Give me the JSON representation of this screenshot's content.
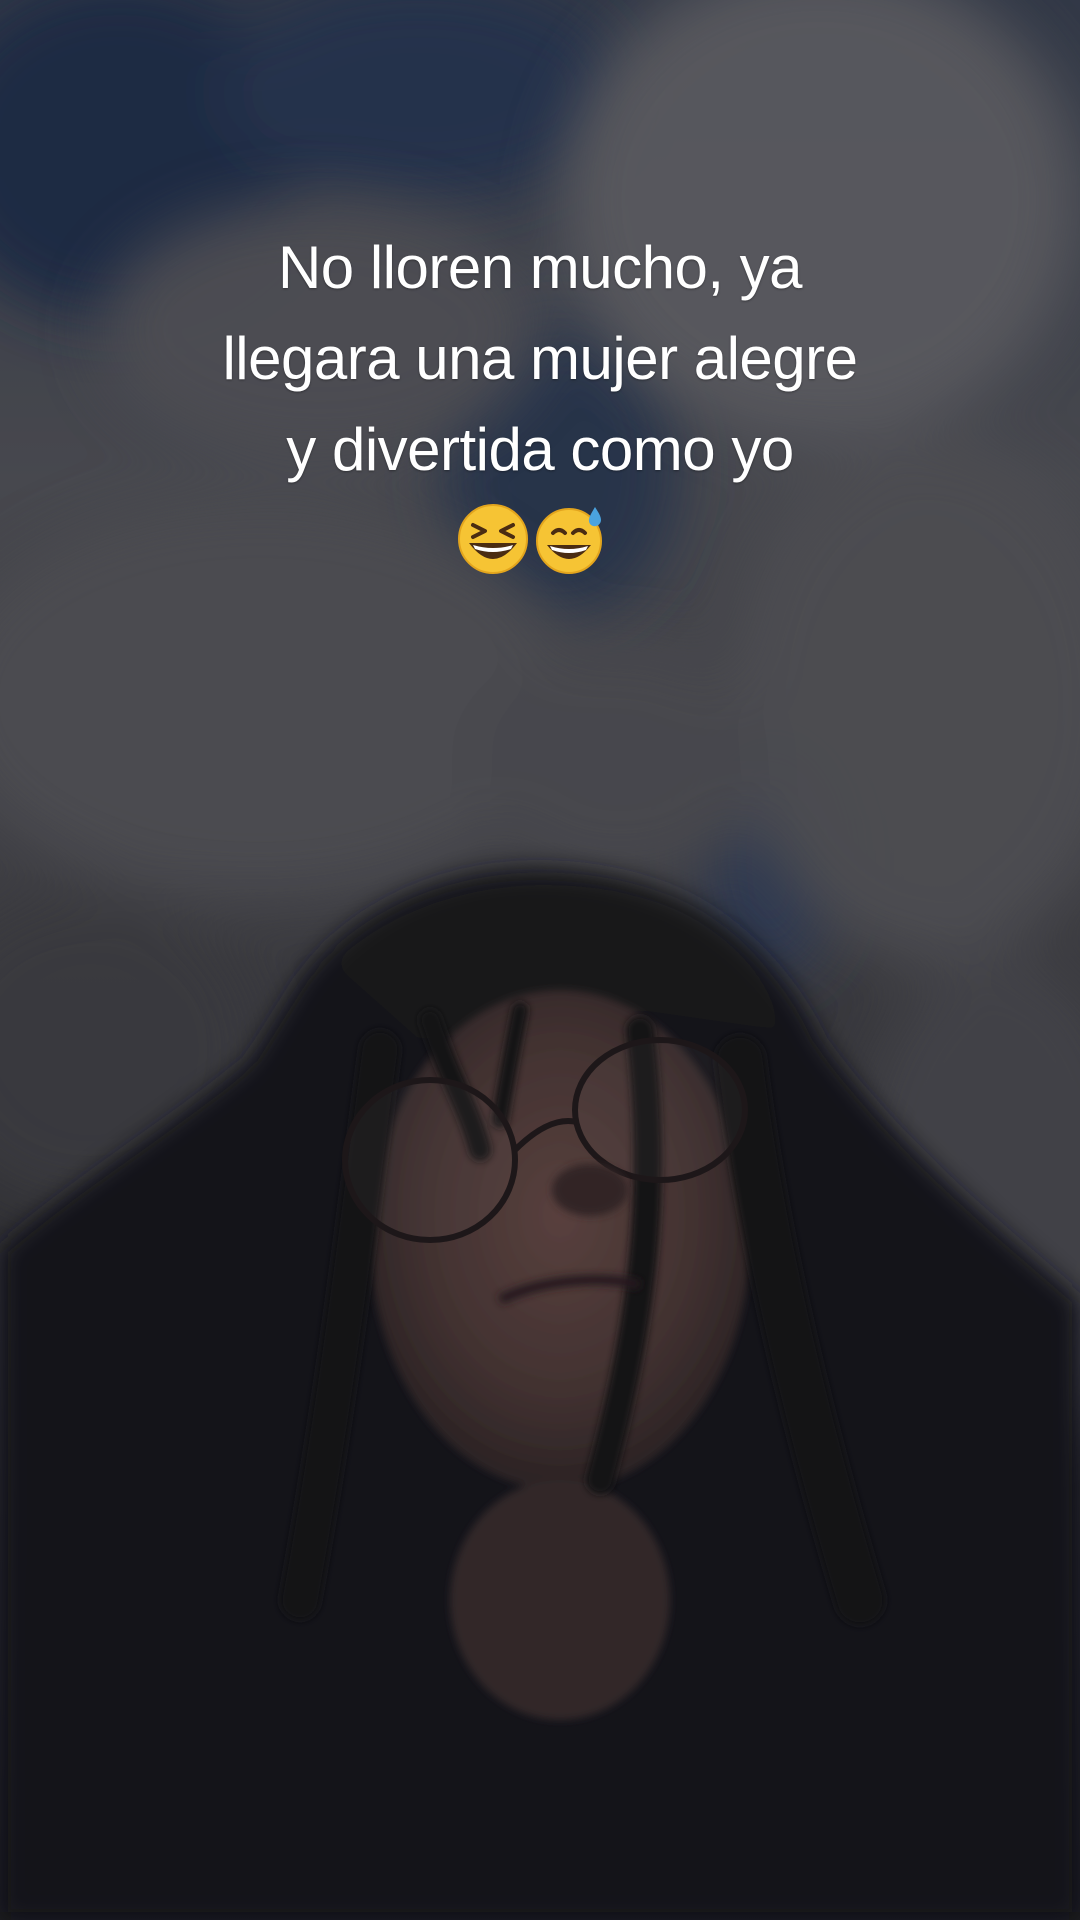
{
  "caption": {
    "lines": [
      "No lloren mucho, ya",
      "llegara una mujer alegre",
      "y divertida como yo"
    ],
    "emoji_names": [
      "grinning-squinting-face-icon",
      "grinning-face-with-sweat-icon"
    ]
  },
  "colors": {
    "sky": "#3b4353",
    "clouds": "#5d5d62",
    "hair": "#141417",
    "skin": "#5a4340",
    "text": "#ffffff"
  }
}
